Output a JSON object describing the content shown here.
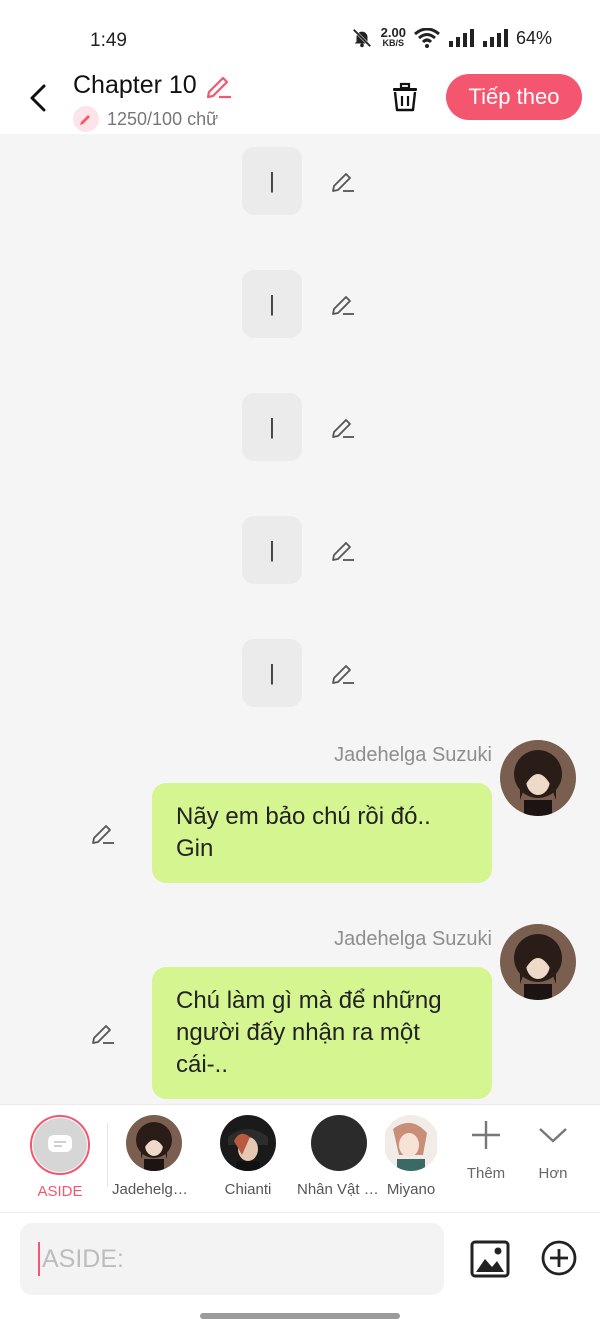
{
  "status_bar": {
    "time": "1:49",
    "speed_value": "2.00",
    "speed_unit": "KB/S",
    "battery": "64%"
  },
  "header": {
    "title": "Chapter 10",
    "word_count": "1250/100 chữ",
    "next_label": "Tiếp theo",
    "accent": "#f5566f"
  },
  "chat": {
    "aside_items": [
      "|",
      "|",
      "|",
      "|",
      "|"
    ],
    "messages": [
      {
        "sender": "Jadehelga Suzuki",
        "text": "Nãy em bảo chú rồi đó.. Gin"
      },
      {
        "sender": "Jadehelga Suzuki",
        "text": "Chú làm gì mà để những người đấy nhận ra một cái-.."
      }
    ],
    "bubble_color": "#d5f590"
  },
  "characters": [
    {
      "label": "ASIDE",
      "selected": true
    },
    {
      "label": "Jadehelga Suzuki"
    },
    {
      "label": "Chianti"
    },
    {
      "label": "Nhân Vật Phụ"
    },
    {
      "label": "Miyano"
    }
  ],
  "tools": {
    "more_label": "Thêm",
    "less_label": "Hơn"
  },
  "input": {
    "placeholder": "ASIDE:"
  }
}
